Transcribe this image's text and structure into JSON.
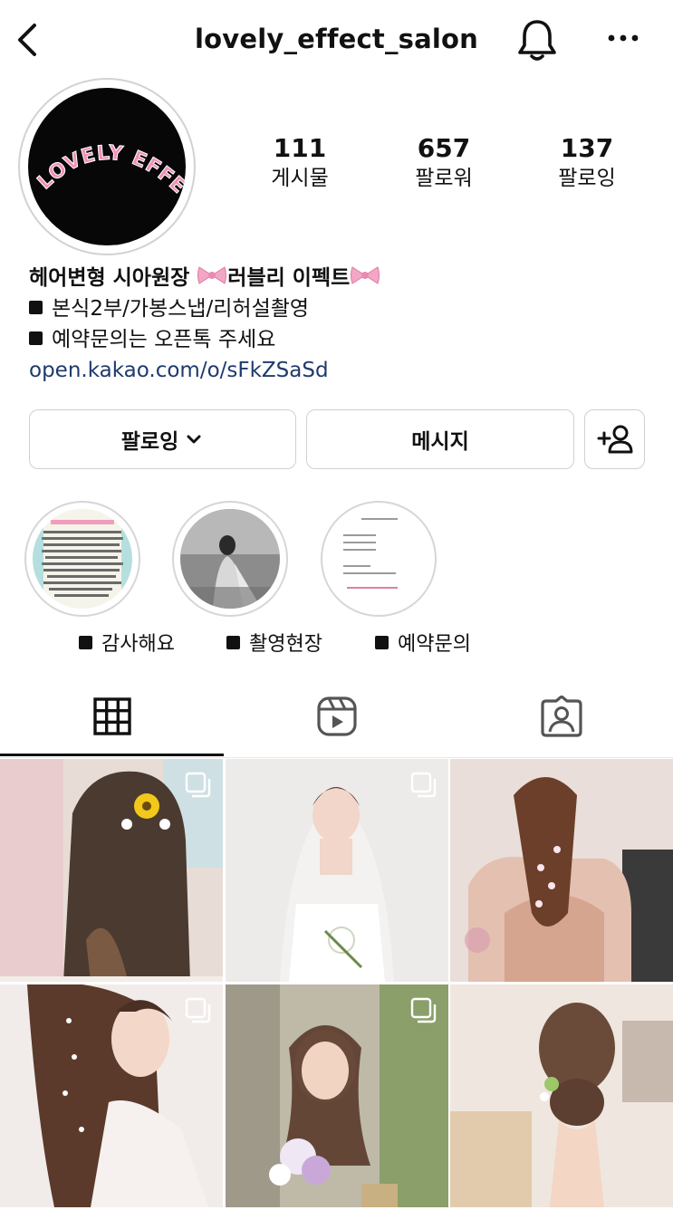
{
  "header": {
    "username": "lovely_effect_salon",
    "back_icon": "chevron-left-icon",
    "bell_icon": "bell-icon",
    "more_icon": "more-horizontal-icon"
  },
  "profile": {
    "avatar_text": "LOVELY EFFECT",
    "stats": [
      {
        "value": "111",
        "label": "게시물"
      },
      {
        "value": "657",
        "label": "팔로워"
      },
      {
        "value": "137",
        "label": "팔로잉"
      }
    ],
    "bio": {
      "name_part1": "헤어변형 시아원장 ",
      "name_part2": "러블리 이펙트",
      "line1": "본식2부/가봉스냅/리허설촬영",
      "line2": "예약문의는 오픈톡 주세요",
      "link": "open.kakao.com/o/sFkZSaSd"
    }
  },
  "actions": {
    "following_label": "팔로잉",
    "message_label": "메시지",
    "add_user_icon": "add-user-icon"
  },
  "highlights": [
    {
      "label": "감사해요"
    },
    {
      "label": "촬영현장"
    },
    {
      "label": "예약문의"
    }
  ],
  "tabs": [
    {
      "icon": "grid-icon",
      "active": true
    },
    {
      "icon": "reels-icon",
      "active": false
    },
    {
      "icon": "tagged-icon",
      "active": false
    }
  ],
  "colors": {
    "link": "#1e3a6e",
    "avatar_text": "#f08fb5",
    "bow": "#f4a6c6"
  }
}
